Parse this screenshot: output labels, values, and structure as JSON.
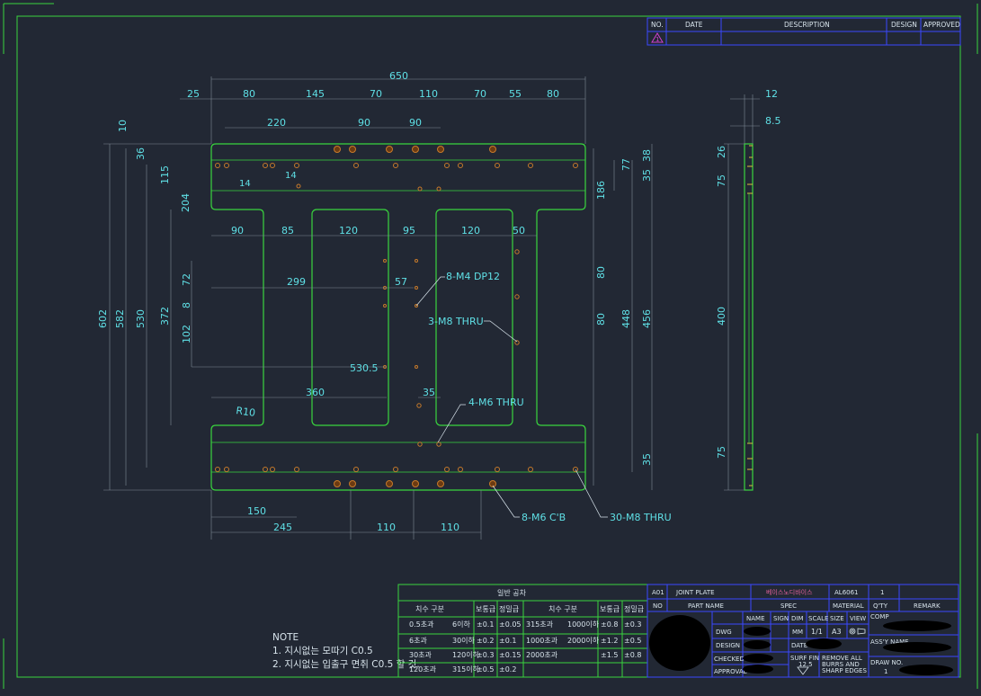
{
  "revision_block": {
    "headers": [
      "NO.",
      "DATE",
      "DESCRIPTION",
      "DESIGN",
      "APPROVED"
    ]
  },
  "plan_view": {
    "overall_width": "650",
    "top_segments": [
      "25",
      "80",
      "145",
      "70",
      "110",
      "70",
      "55",
      "80"
    ],
    "second_row": [
      "220",
      "90",
      "90"
    ],
    "left_heights": [
      "602",
      "582",
      "530",
      "372"
    ],
    "left_small": [
      "10",
      "36",
      "115",
      "204",
      "72",
      "8",
      "102"
    ],
    "small_14a": "14",
    "small_14b": "14",
    "opening_widths": [
      "90",
      "85",
      "120",
      "95",
      "120",
      "50"
    ],
    "dim_299": "299",
    "dim_57": "57",
    "dim_530_5": "530.5",
    "dim_360": "360",
    "dim_35_mid": "35",
    "radius": "R10",
    "right_dims": [
      "38",
      "77",
      "35",
      "186",
      "80",
      "80",
      "448",
      "456",
      "35"
    ],
    "bottom_dims": [
      "150",
      "245",
      "110",
      "110"
    ],
    "callouts": [
      "8-M4 DP12",
      "3-M8 THRU",
      "4-M6 THRU",
      "8-M6 C'B",
      "30-M8 THRU"
    ]
  },
  "side_view": {
    "top_dims": [
      "12",
      "8.5"
    ],
    "vertical_dims": [
      "26",
      "75",
      "400",
      "75"
    ]
  },
  "notes": {
    "title": "NOTE",
    "lines": [
      "1. 지시없는 모따기 C0.5",
      "2. 지시없는 입출구 면취 C0.5 할 것."
    ]
  },
  "tolerance_table": {
    "title": "일반 공차",
    "headers": [
      "치수 구분",
      "보통급",
      "정밀급",
      "치수 구분",
      "보통급",
      "정밀급"
    ],
    "rows": [
      [
        "0.5초과",
        "6이하",
        "±0.1",
        "±0.05",
        "315초과",
        "1000이하",
        "±0.8",
        "±0.3"
      ],
      [
        "6초과",
        "30이하",
        "±0.2",
        "±0.1",
        "1000초과",
        "2000이하",
        "±1.2",
        "±0.5"
      ],
      [
        "30초과",
        "120이하",
        "±0.3",
        "±0.15",
        "2000초과",
        "",
        "±1.5",
        "±0.8"
      ],
      [
        "120초과",
        "315이하",
        "±0.5",
        "±0.2",
        "",
        "",
        "",
        ""
      ]
    ]
  },
  "title_block": {
    "part_no": "A01",
    "part_name": "JOINT PLATE",
    "spec": "베이스노디바이스",
    "material": "AL6061",
    "qty": "1",
    "headers": [
      "NO",
      "PART NAME",
      "SPEC",
      "MATERIAL",
      "Q'TY",
      "REMARK"
    ],
    "comp_label": "COMP",
    "info_headers": [
      "NAME",
      "SIGN",
      "DIM",
      "SCALE",
      "SIZE",
      "VIEW"
    ],
    "dwg_label": "DWG",
    "design_label": "DESIGN",
    "checked_label": "CHECKED",
    "approval_label": "APPROVAL",
    "date_label": "DATE",
    "dim_unit": "MM",
    "scale": "1/1",
    "size": "A3",
    "surf_fin": "SURF FIN",
    "surf_val": "12.5",
    "remove_burrs": [
      "REMOVE ALL",
      "BURRS AND",
      "SHARP EDGES"
    ],
    "assy_label": "ASS'Y NAME",
    "drawno_label": "DRAW NO.",
    "drawno_val": "1"
  },
  "colors": {
    "background": "#222834",
    "border": "#39d43e",
    "plate": "#39d43e",
    "dimension": "#5fe0e6",
    "title_block": "#3a48ff",
    "hole": "#c77a2a",
    "redacted": "#000000"
  }
}
